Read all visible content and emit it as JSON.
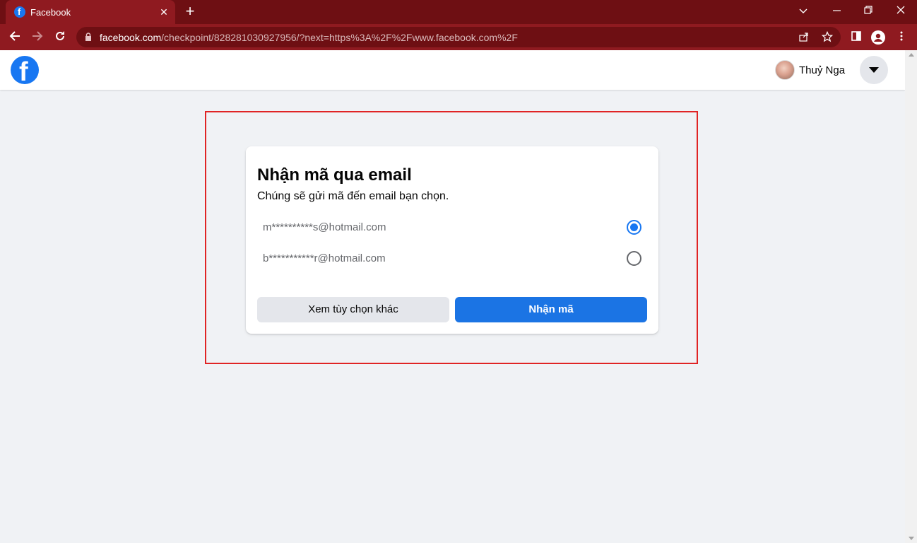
{
  "browser": {
    "tab_title": "Facebook",
    "tab_close": "✕",
    "new_tab": "+",
    "url_host": "facebook.com",
    "url_path": "/checkpoint/828281030927956/?next=https%3A%2F%2Fwww.facebook.com%2F",
    "icons": [
      "back-icon",
      "forward-icon",
      "reload-icon",
      "lock-icon",
      "share-icon",
      "star-icon",
      "sidebar-icon",
      "profile-icon",
      "menu-icon",
      "minimize-icon",
      "restore-icon",
      "close-icon",
      "tab-search-icon"
    ]
  },
  "header": {
    "user_name": "Thuỷ Nga"
  },
  "card": {
    "title": "Nhận mã qua email",
    "subtitle": "Chúng sẽ gửi mã đến email bạn chọn.",
    "options": [
      {
        "label": "m**********s@hotmail.com",
        "selected": true
      },
      {
        "label": "b***********r@hotmail.com",
        "selected": false
      }
    ],
    "secondary_button": "Xem tùy chọn khác",
    "primary_button": "Nhận mã"
  },
  "colors": {
    "chrome_dark": "#6e0f13",
    "chrome_tab": "#8f1a20",
    "fb_blue": "#1877f2",
    "highlight": "#e02424"
  }
}
